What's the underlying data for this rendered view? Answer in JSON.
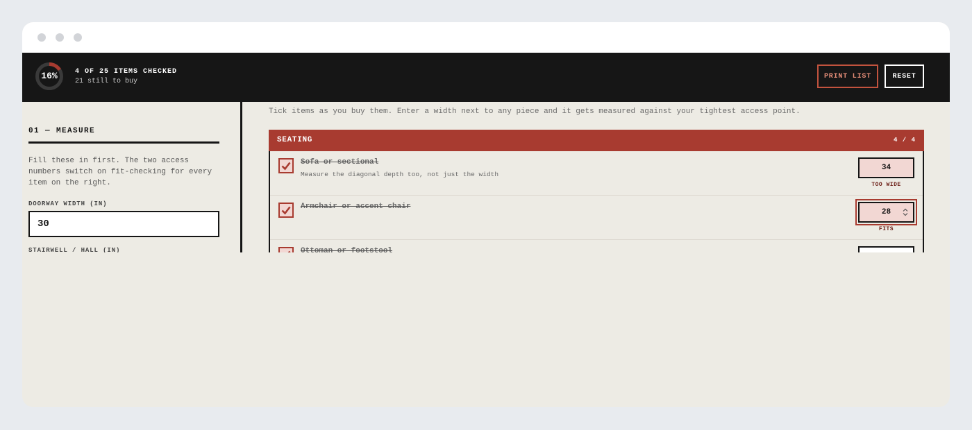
{
  "window": {
    "controls": [
      "close",
      "minimize",
      "maximize"
    ]
  },
  "progress": {
    "percent": 16,
    "percent_label": "16%",
    "title": "4 OF 25 ITEMS CHECKED",
    "subtitle": "21 still to buy",
    "ring_color": "#a83b30"
  },
  "actions": {
    "print_label": "PRINT LIST",
    "reset_label": "RESET"
  },
  "measure": {
    "title": "01 — MEASURE",
    "description": "Fill these in first. The two access numbers switch on fit-checking for every item on the right.",
    "doorway_label": "DOORWAY WIDTH (IN)",
    "doorway_value": "30",
    "stairwell_label": "STAIRWELL / HALL (IN)"
  },
  "checklist": {
    "intro": "Tick items as you buy them. Enter a width next to any piece and it gets measured against your tightest access point.",
    "group": {
      "name": "SEATING",
      "count": "4 / 4",
      "items": [
        {
          "name": "Sofa or sectional",
          "note": "Measure the diagonal depth too, not just the width",
          "checked": true,
          "width": "34",
          "fit": "TOO WIDE"
        },
        {
          "name": "Armchair or accent chair",
          "note": "",
          "checked": true,
          "width": "28",
          "fit": "FITS"
        },
        {
          "name": "Ottoman or footstool",
          "note": "",
          "checked": true,
          "width": "",
          "fit": ""
        }
      ]
    }
  },
  "colors": {
    "accent": "#a83b30",
    "dark": "#161616",
    "paper": "#edebe4",
    "input_fill": "#f2d7d3"
  }
}
